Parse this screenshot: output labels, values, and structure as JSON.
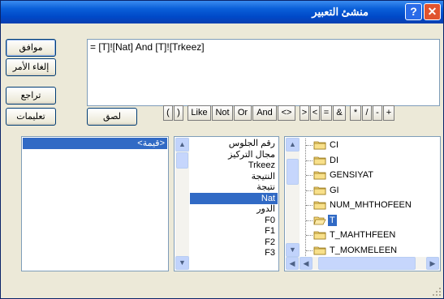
{
  "window": {
    "title": "منشئ التعبير",
    "help_glyph": "?",
    "close_glyph": "✕"
  },
  "buttons": {
    "ok": "موافق",
    "cancel": "إلغاء الأمر",
    "undo": "تراجع",
    "help": "تعليمات",
    "paste": "لصق"
  },
  "expression": "= [T]![Nat] And [T]![Trkeez]",
  "operators": [
    "(",
    ")",
    "Like",
    "Not",
    "Or",
    "And",
    "<>",
    ">",
    "<",
    "=",
    "&",
    "*",
    "/",
    "-",
    "+"
  ],
  "left_list": {
    "items": [
      "<قيمة>"
    ],
    "selected_index": 0
  },
  "middle_list": {
    "items": [
      "رقم الجلوس",
      "مجال التركيز",
      "Trkeez",
      "النتيجة",
      "نتيجة",
      "Nat",
      "الدور",
      "F0",
      "F1",
      "F2",
      "F3"
    ],
    "selected_index": 5
  },
  "tree": {
    "items": [
      "CI",
      "DI",
      "GENSIYAT",
      "GI",
      "NUM_MHTHOFEEN",
      "T",
      "T_MAHTHFEEN",
      "T_MOKMELEEN"
    ],
    "selected_index": 5
  },
  "colors": {
    "title_bar": "#0a5fd8",
    "selection": "#316ac5",
    "dialog_bg": "#ece9d8"
  }
}
